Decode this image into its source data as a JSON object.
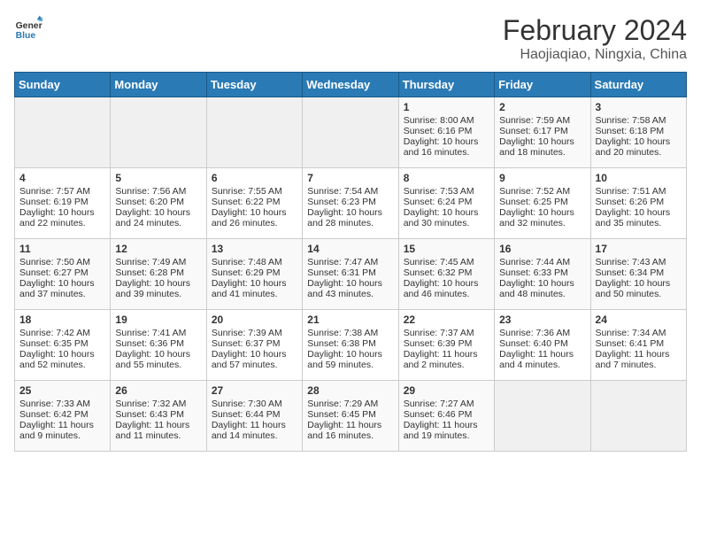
{
  "header": {
    "logo_line1": "General",
    "logo_line2": "Blue",
    "month_year": "February 2024",
    "location": "Haojiaqiao, Ningxia, China"
  },
  "days_of_week": [
    "Sunday",
    "Monday",
    "Tuesday",
    "Wednesday",
    "Thursday",
    "Friday",
    "Saturday"
  ],
  "weeks": [
    [
      {
        "day": "",
        "sunrise": "",
        "sunset": "",
        "daylight": "",
        "empty": true
      },
      {
        "day": "",
        "sunrise": "",
        "sunset": "",
        "daylight": "",
        "empty": true
      },
      {
        "day": "",
        "sunrise": "",
        "sunset": "",
        "daylight": "",
        "empty": true
      },
      {
        "day": "",
        "sunrise": "",
        "sunset": "",
        "daylight": "",
        "empty": true
      },
      {
        "day": "1",
        "sunrise": "Sunrise: 8:00 AM",
        "sunset": "Sunset: 6:16 PM",
        "daylight": "Daylight: 10 hours and 16 minutes."
      },
      {
        "day": "2",
        "sunrise": "Sunrise: 7:59 AM",
        "sunset": "Sunset: 6:17 PM",
        "daylight": "Daylight: 10 hours and 18 minutes."
      },
      {
        "day": "3",
        "sunrise": "Sunrise: 7:58 AM",
        "sunset": "Sunset: 6:18 PM",
        "daylight": "Daylight: 10 hours and 20 minutes."
      }
    ],
    [
      {
        "day": "4",
        "sunrise": "Sunrise: 7:57 AM",
        "sunset": "Sunset: 6:19 PM",
        "daylight": "Daylight: 10 hours and 22 minutes."
      },
      {
        "day": "5",
        "sunrise": "Sunrise: 7:56 AM",
        "sunset": "Sunset: 6:20 PM",
        "daylight": "Daylight: 10 hours and 24 minutes."
      },
      {
        "day": "6",
        "sunrise": "Sunrise: 7:55 AM",
        "sunset": "Sunset: 6:22 PM",
        "daylight": "Daylight: 10 hours and 26 minutes."
      },
      {
        "day": "7",
        "sunrise": "Sunrise: 7:54 AM",
        "sunset": "Sunset: 6:23 PM",
        "daylight": "Daylight: 10 hours and 28 minutes."
      },
      {
        "day": "8",
        "sunrise": "Sunrise: 7:53 AM",
        "sunset": "Sunset: 6:24 PM",
        "daylight": "Daylight: 10 hours and 30 minutes."
      },
      {
        "day": "9",
        "sunrise": "Sunrise: 7:52 AM",
        "sunset": "Sunset: 6:25 PM",
        "daylight": "Daylight: 10 hours and 32 minutes."
      },
      {
        "day": "10",
        "sunrise": "Sunrise: 7:51 AM",
        "sunset": "Sunset: 6:26 PM",
        "daylight": "Daylight: 10 hours and 35 minutes."
      }
    ],
    [
      {
        "day": "11",
        "sunrise": "Sunrise: 7:50 AM",
        "sunset": "Sunset: 6:27 PM",
        "daylight": "Daylight: 10 hours and 37 minutes."
      },
      {
        "day": "12",
        "sunrise": "Sunrise: 7:49 AM",
        "sunset": "Sunset: 6:28 PM",
        "daylight": "Daylight: 10 hours and 39 minutes."
      },
      {
        "day": "13",
        "sunrise": "Sunrise: 7:48 AM",
        "sunset": "Sunset: 6:29 PM",
        "daylight": "Daylight: 10 hours and 41 minutes."
      },
      {
        "day": "14",
        "sunrise": "Sunrise: 7:47 AM",
        "sunset": "Sunset: 6:31 PM",
        "daylight": "Daylight: 10 hours and 43 minutes."
      },
      {
        "day": "15",
        "sunrise": "Sunrise: 7:45 AM",
        "sunset": "Sunset: 6:32 PM",
        "daylight": "Daylight: 10 hours and 46 minutes."
      },
      {
        "day": "16",
        "sunrise": "Sunrise: 7:44 AM",
        "sunset": "Sunset: 6:33 PM",
        "daylight": "Daylight: 10 hours and 48 minutes."
      },
      {
        "day": "17",
        "sunrise": "Sunrise: 7:43 AM",
        "sunset": "Sunset: 6:34 PM",
        "daylight": "Daylight: 10 hours and 50 minutes."
      }
    ],
    [
      {
        "day": "18",
        "sunrise": "Sunrise: 7:42 AM",
        "sunset": "Sunset: 6:35 PM",
        "daylight": "Daylight: 10 hours and 52 minutes."
      },
      {
        "day": "19",
        "sunrise": "Sunrise: 7:41 AM",
        "sunset": "Sunset: 6:36 PM",
        "daylight": "Daylight: 10 hours and 55 minutes."
      },
      {
        "day": "20",
        "sunrise": "Sunrise: 7:39 AM",
        "sunset": "Sunset: 6:37 PM",
        "daylight": "Daylight: 10 hours and 57 minutes."
      },
      {
        "day": "21",
        "sunrise": "Sunrise: 7:38 AM",
        "sunset": "Sunset: 6:38 PM",
        "daylight": "Daylight: 10 hours and 59 minutes."
      },
      {
        "day": "22",
        "sunrise": "Sunrise: 7:37 AM",
        "sunset": "Sunset: 6:39 PM",
        "daylight": "Daylight: 11 hours and 2 minutes."
      },
      {
        "day": "23",
        "sunrise": "Sunrise: 7:36 AM",
        "sunset": "Sunset: 6:40 PM",
        "daylight": "Daylight: 11 hours and 4 minutes."
      },
      {
        "day": "24",
        "sunrise": "Sunrise: 7:34 AM",
        "sunset": "Sunset: 6:41 PM",
        "daylight": "Daylight: 11 hours and 7 minutes."
      }
    ],
    [
      {
        "day": "25",
        "sunrise": "Sunrise: 7:33 AM",
        "sunset": "Sunset: 6:42 PM",
        "daylight": "Daylight: 11 hours and 9 minutes."
      },
      {
        "day": "26",
        "sunrise": "Sunrise: 7:32 AM",
        "sunset": "Sunset: 6:43 PM",
        "daylight": "Daylight: 11 hours and 11 minutes."
      },
      {
        "day": "27",
        "sunrise": "Sunrise: 7:30 AM",
        "sunset": "Sunset: 6:44 PM",
        "daylight": "Daylight: 11 hours and 14 minutes."
      },
      {
        "day": "28",
        "sunrise": "Sunrise: 7:29 AM",
        "sunset": "Sunset: 6:45 PM",
        "daylight": "Daylight: 11 hours and 16 minutes."
      },
      {
        "day": "29",
        "sunrise": "Sunrise: 7:27 AM",
        "sunset": "Sunset: 6:46 PM",
        "daylight": "Daylight: 11 hours and 19 minutes."
      },
      {
        "day": "",
        "sunrise": "",
        "sunset": "",
        "daylight": "",
        "empty": true
      },
      {
        "day": "",
        "sunrise": "",
        "sunset": "",
        "daylight": "",
        "empty": true
      }
    ]
  ]
}
